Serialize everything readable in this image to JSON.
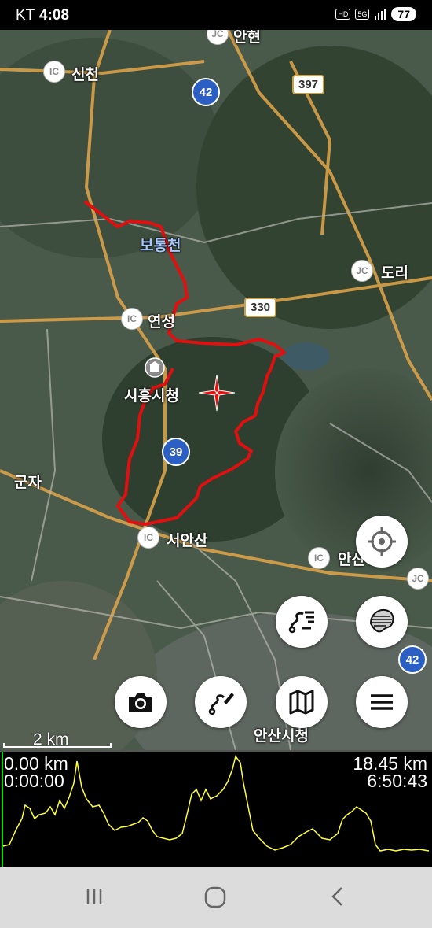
{
  "status_bar": {
    "carrier": "KT",
    "time": "4:08",
    "battery": "77",
    "hd": "HD",
    "network": "5G"
  },
  "map": {
    "place_labels": [
      {
        "text": "신천"
      },
      {
        "text": "안현"
      },
      {
        "text": "보통천"
      },
      {
        "text": "연성"
      },
      {
        "text": "시흥시청"
      },
      {
        "text": "군자"
      },
      {
        "text": "서안산"
      },
      {
        "text": "도리"
      },
      {
        "text": "안산"
      },
      {
        "text": "안산시청"
      }
    ],
    "ic_badge": "IC",
    "jc_badge": "JC",
    "route_badges": [
      "397",
      "330"
    ],
    "round_badges": [
      "42",
      "39",
      "42"
    ],
    "scale": "2 km"
  },
  "buttons": {
    "gps": "gps-locate",
    "track_list": "track-list",
    "layer": "map-layer",
    "camera": "camera",
    "draw_route": "draw-route",
    "map": "map-select",
    "menu": "menu"
  },
  "profile": {
    "start_distance": "0.00 km",
    "start_time": "0:00:00",
    "end_distance": "18.45 km",
    "end_time": "6:50:43",
    "colors": {
      "line": "#ffff33",
      "marker": "#00e000"
    }
  },
  "colors": {
    "track": "#e01010",
    "cursor": "#e81010"
  }
}
